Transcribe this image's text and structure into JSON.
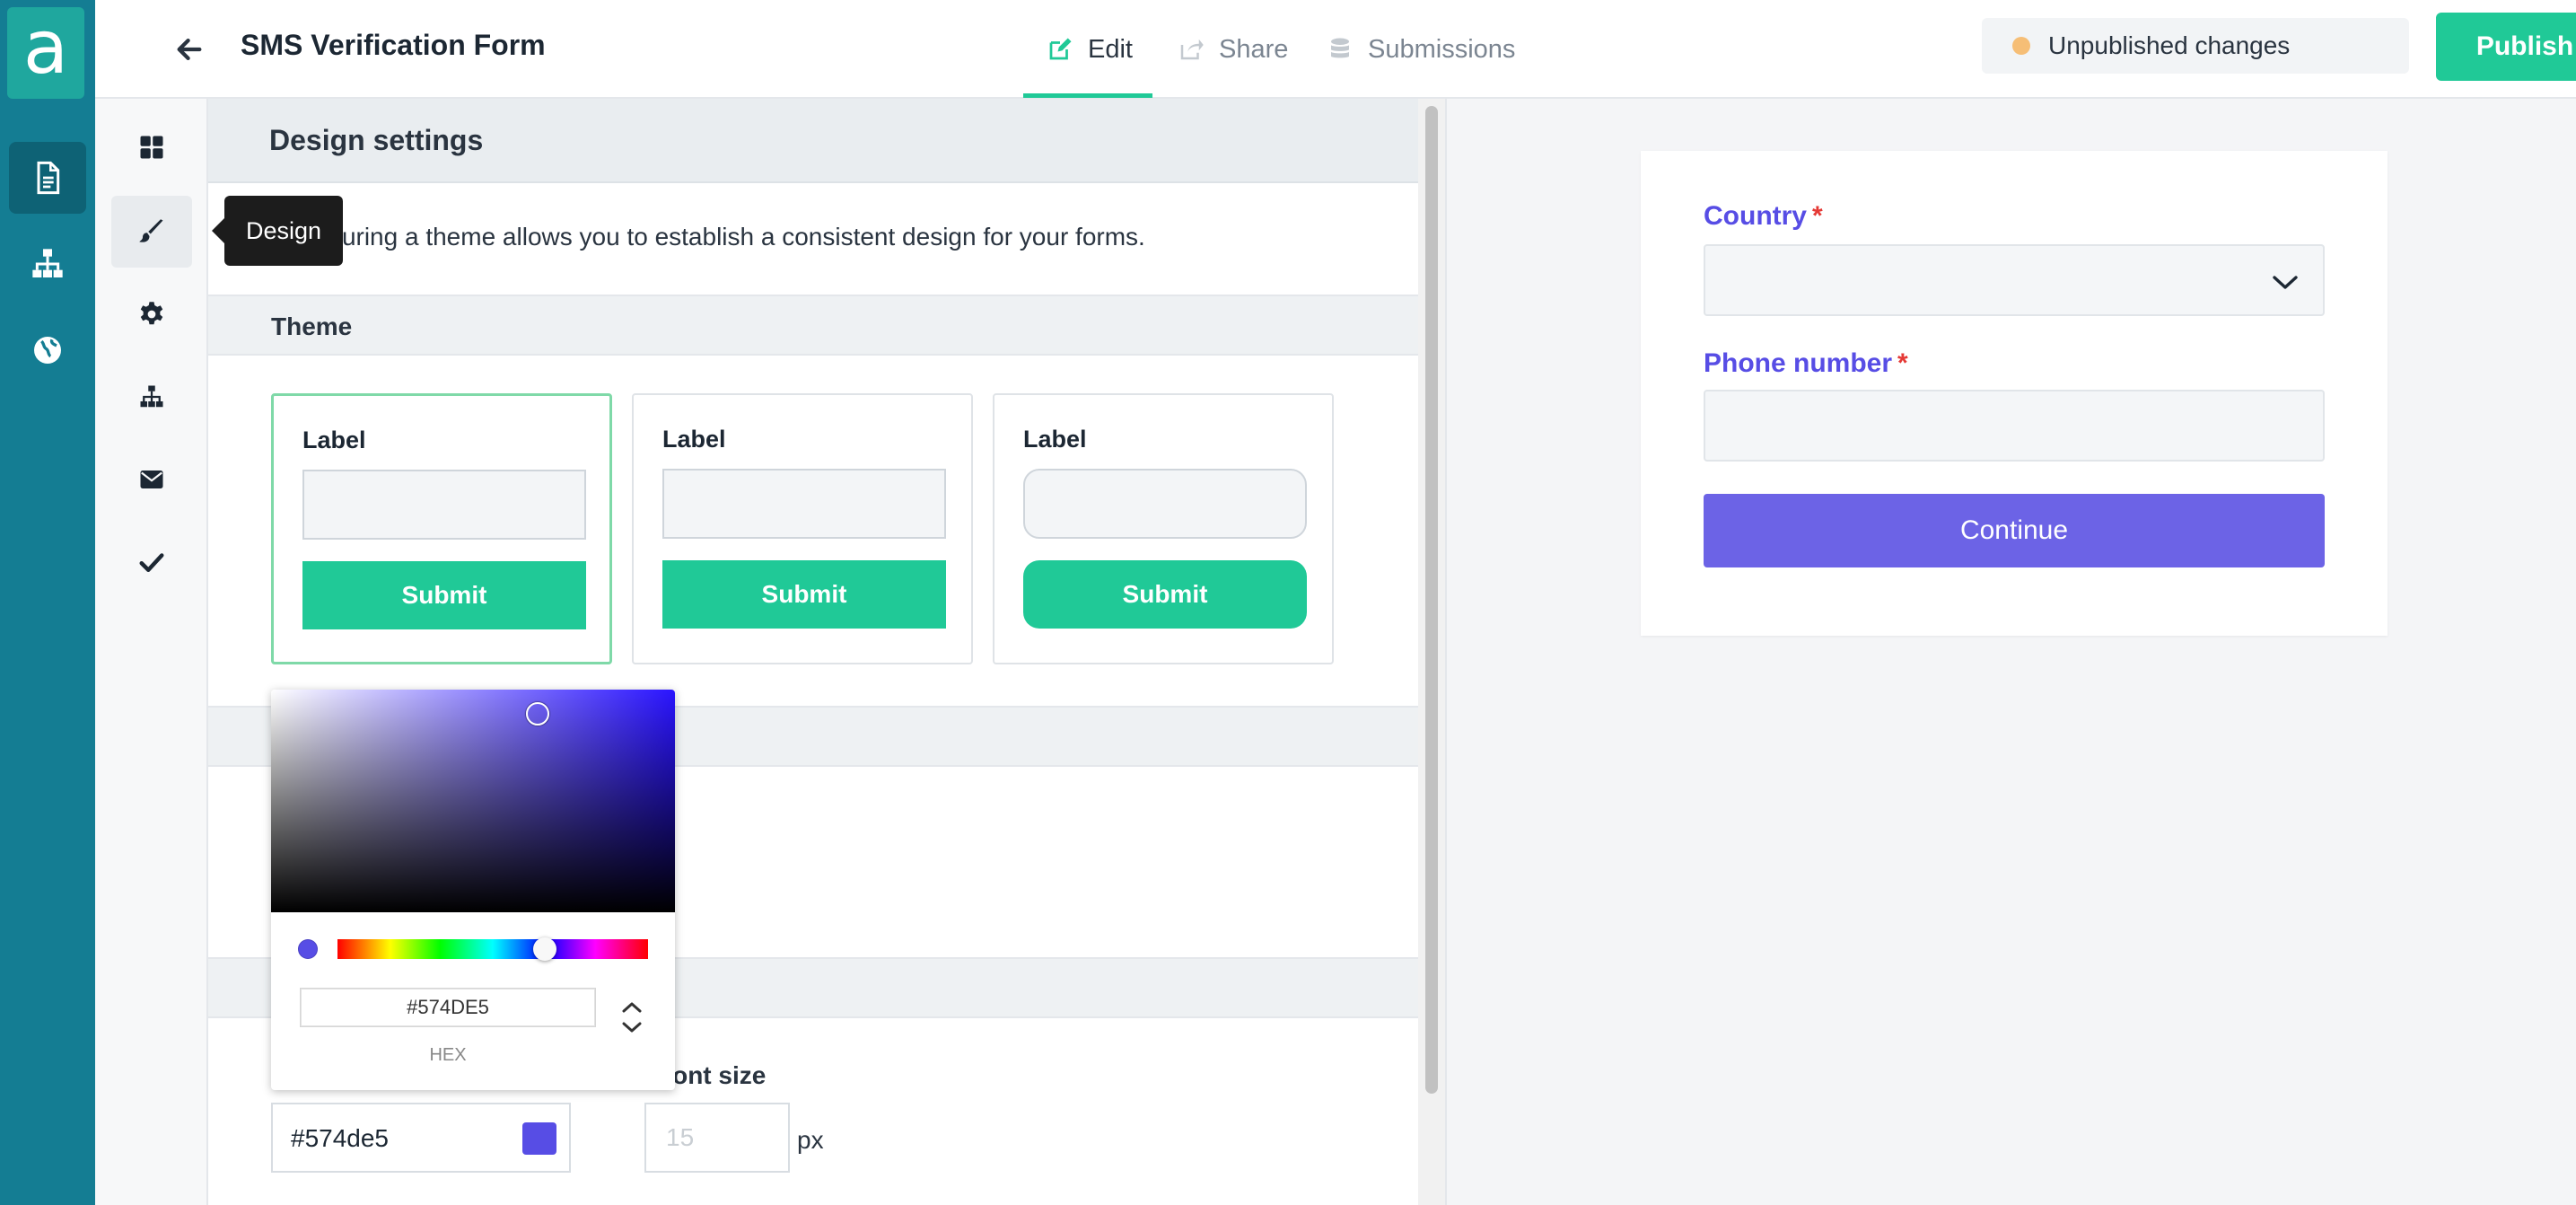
{
  "rail": {
    "logo": "a",
    "items": [
      "forms",
      "workflows",
      "sites"
    ]
  },
  "header": {
    "title": "SMS Verification Form",
    "tabs": [
      {
        "label": "Edit",
        "icon": "edit-icon",
        "active": true
      },
      {
        "label": "Share",
        "icon": "share-icon"
      },
      {
        "label": "Submissions",
        "icon": "database-icon"
      }
    ],
    "status": "Unpublished changes",
    "publish_label": "Publish"
  },
  "subnav": {
    "tooltip": "Design"
  },
  "design": {
    "heading": "Design settings",
    "description": "Configuring a theme allows you to establish a consistent design for your forms.",
    "theme_section": "Theme",
    "themes": [
      {
        "label": "Label",
        "button": "Submit",
        "selected": true
      },
      {
        "label": "Label",
        "button": "Submit"
      },
      {
        "label": "Label",
        "button": "Submit"
      }
    ],
    "font_size_label": "Font size",
    "color_value": "#574de5",
    "font_size_placeholder": "15",
    "font_size_unit": "px"
  },
  "color_picker": {
    "hex": "#574DE5",
    "caption": "HEX",
    "swatch_color": "#574de5"
  },
  "preview": {
    "country_label": "Country",
    "phone_label": "Phone number",
    "required_mark": "*",
    "continue_label": "Continue"
  },
  "colors": {
    "accent": "#20c997",
    "brand": "#147d93",
    "form_primary": "#574de5"
  }
}
